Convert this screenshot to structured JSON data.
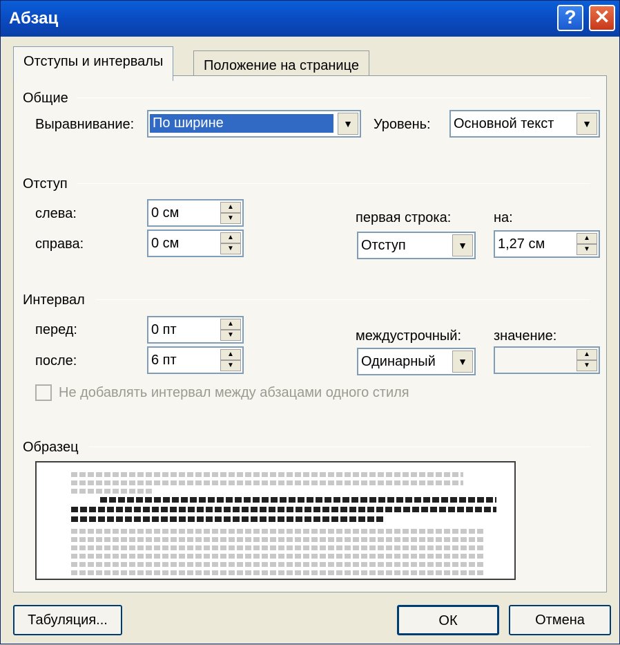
{
  "window": {
    "title": "Абзац"
  },
  "titlebar": {
    "help_symbol": "?",
    "close_symbol": "✕"
  },
  "tabs": [
    {
      "label": "Отступы и интервалы",
      "active": true
    },
    {
      "label": "Положение на странице",
      "active": false
    }
  ],
  "general": {
    "label": "Общие",
    "alignment_label": "Выравнивание:",
    "alignment_value": "По ширине",
    "level_label": "Уровень:",
    "level_value": "Основной текст"
  },
  "indent": {
    "label": "Отступ",
    "left_label": "слева:",
    "left_value": "0 см",
    "right_label": "справа:",
    "right_value": "0 см",
    "first_line_label": "первая строка:",
    "first_line_value": "Отступ",
    "by_label": "на:",
    "by_value": "1,27 см"
  },
  "spacing": {
    "label": "Интервал",
    "before_label": "перед:",
    "before_value": "0 пт",
    "after_label": "после:",
    "after_value": "6 пт",
    "line_label": "междустрочный:",
    "line_value": "Одинарный",
    "value_label": "значение:",
    "value_value": ""
  },
  "dont_add_space": {
    "label": "Не добавлять интервал между абзацами одного стиля",
    "checked": false,
    "enabled": false
  },
  "preview": {
    "label": "Образец"
  },
  "buttons": {
    "tabs": "Табуляция...",
    "ok": "ОК",
    "cancel": "Отмена"
  },
  "icons": {
    "dropdown": "▼",
    "up": "▲",
    "down": "▼"
  },
  "colors": {
    "titlebar": "#0a4bc2",
    "selection": "#316ac5",
    "dialog_bg": "#ece9d8"
  }
}
